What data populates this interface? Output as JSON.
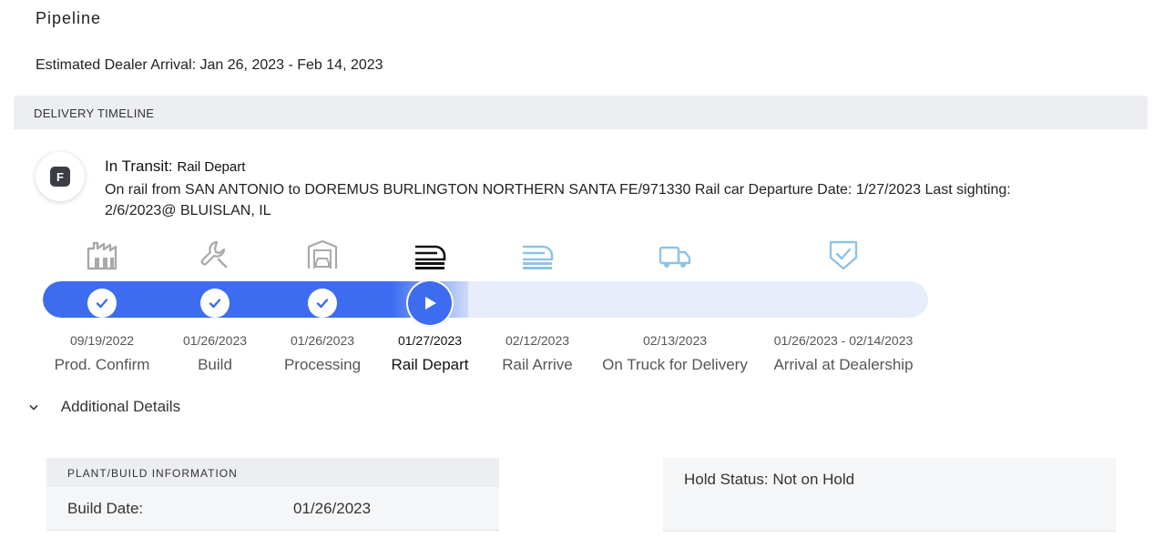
{
  "page": {
    "title": "Pipeline",
    "eta": "Estimated Dealer Arrival: Jan 26, 2023 - Feb 14, 2023"
  },
  "timeline": {
    "header": "DELIVERY TIMELINE",
    "badge": "F",
    "status_label": "In Transit:",
    "status_value": "Rail Depart",
    "description": "On rail from SAN ANTONIO to DOREMUS BURLINGTON NORTHERN SANTA FE/971330 Rail car Departure Date: 1/27/2023 Last sighting: 2/6/2023@ BLUISLAN, IL",
    "progress_percent": 48,
    "steps": [
      {
        "date": "09/19/2022",
        "label": "Prod. Confirm",
        "icon": "factory-icon",
        "state": "done"
      },
      {
        "date": "01/26/2023",
        "label": "Build",
        "icon": "wrench-icon",
        "state": "done"
      },
      {
        "date": "01/26/2023",
        "label": "Processing",
        "icon": "car-garage-icon",
        "state": "done"
      },
      {
        "date": "01/27/2023",
        "label": "Rail Depart",
        "icon": "train-icon",
        "state": "current"
      },
      {
        "date": "02/12/2023",
        "label": "Rail Arrive",
        "icon": "train-icon",
        "state": "upcoming"
      },
      {
        "date": "02/13/2023",
        "label": "On Truck for Delivery",
        "icon": "truck-icon",
        "state": "upcoming"
      },
      {
        "date": "01/26/2023 - 02/14/2023",
        "label": "Arrival at Dealership",
        "icon": "shield-check-icon",
        "state": "upcoming"
      }
    ]
  },
  "additional": {
    "label": "Additional Details",
    "plant": {
      "header": "PLANT/BUILD INFORMATION",
      "build_date_label": "Build Date:",
      "build_date_value": "01/26/2023"
    },
    "hold_status": "Hold Status: Not on Hold"
  },
  "colors": {
    "accent": "#3d6cf0",
    "track_bg": "#e7edfb",
    "done_icon": "#a9a9a9",
    "upcoming_icon": "#8fc3e6",
    "current_icon": "#111111"
  }
}
